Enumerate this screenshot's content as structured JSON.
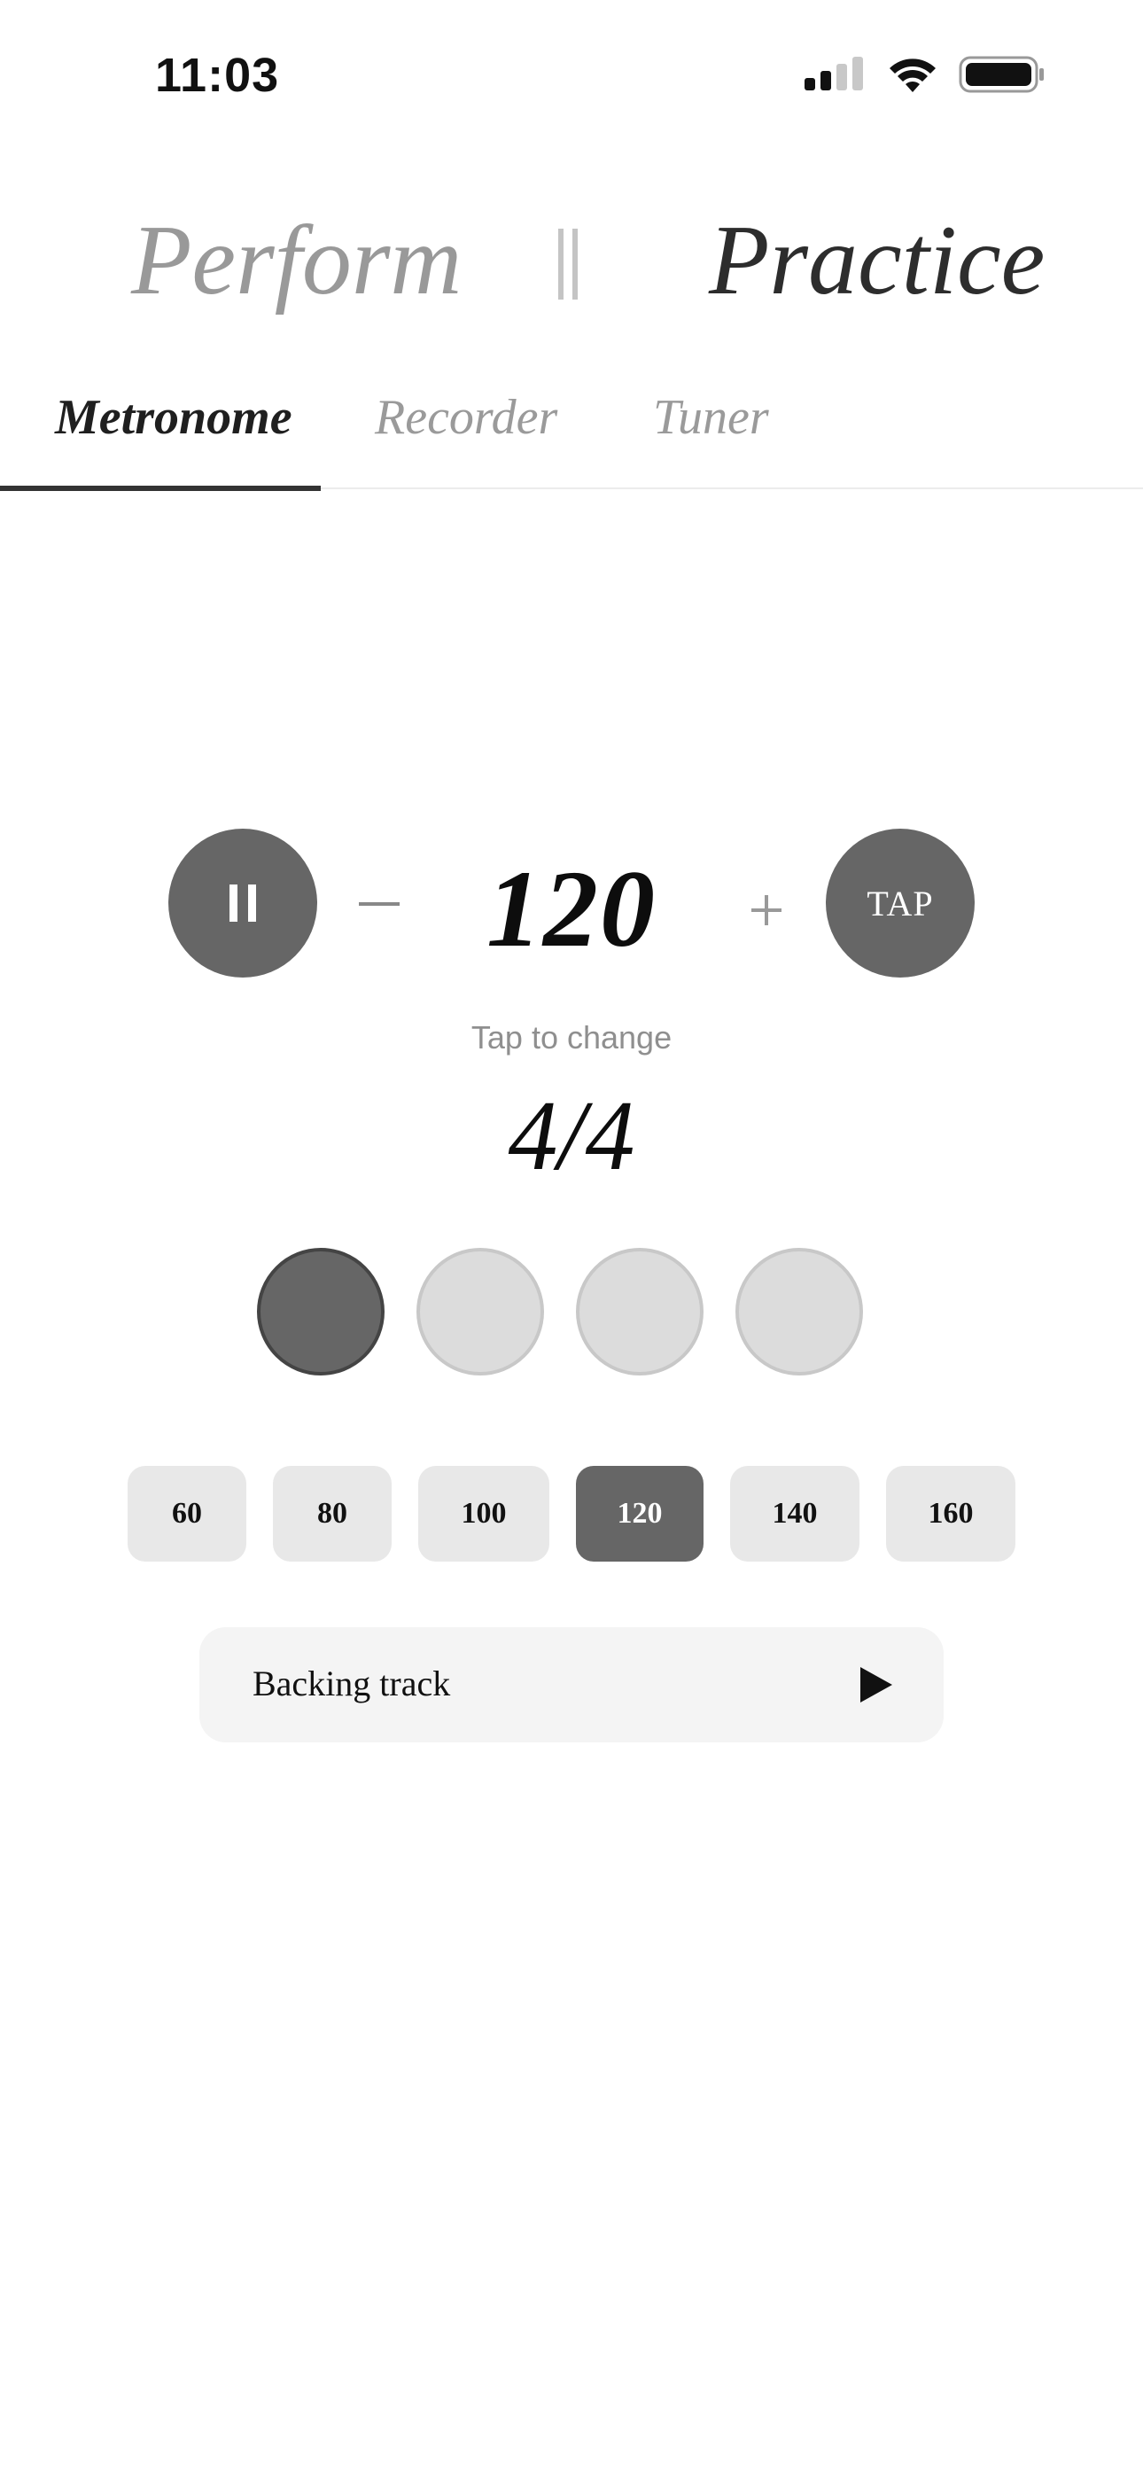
{
  "status_bar": {
    "time": "11:03"
  },
  "modes": {
    "perform": "Perform",
    "practice": "Practice",
    "active": "Practice"
  },
  "tabs": [
    {
      "label": "Metronome",
      "active": true
    },
    {
      "label": "Recorder",
      "active": false
    },
    {
      "label": "Tuner",
      "active": false
    }
  ],
  "metronome": {
    "tempo": "120",
    "tap_label": "TAP",
    "tap_hint": "Tap to change",
    "time_signature": "4/4",
    "beats": [
      {
        "beat": 1,
        "active": true
      },
      {
        "beat": 2,
        "active": false
      },
      {
        "beat": 3,
        "active": false
      },
      {
        "beat": 4,
        "active": false
      }
    ],
    "presets": [
      {
        "label": "60",
        "active": false
      },
      {
        "label": "80",
        "active": false
      },
      {
        "label": "100",
        "active": false
      },
      {
        "label": "120",
        "active": true
      },
      {
        "label": "140",
        "active": false
      },
      {
        "label": "160",
        "active": false
      }
    ]
  },
  "backing_track": {
    "label": "Backing track"
  },
  "colors": {
    "accent": "#666666",
    "inactive_text": "#999999",
    "beat_inactive": "#dcdcdc",
    "preset_bg": "#e8e8e8"
  },
  "icons": [
    "cellular-signal-icon",
    "wifi-icon",
    "battery-icon",
    "pause-icon",
    "minus-icon",
    "plus-icon",
    "play-icon"
  ]
}
